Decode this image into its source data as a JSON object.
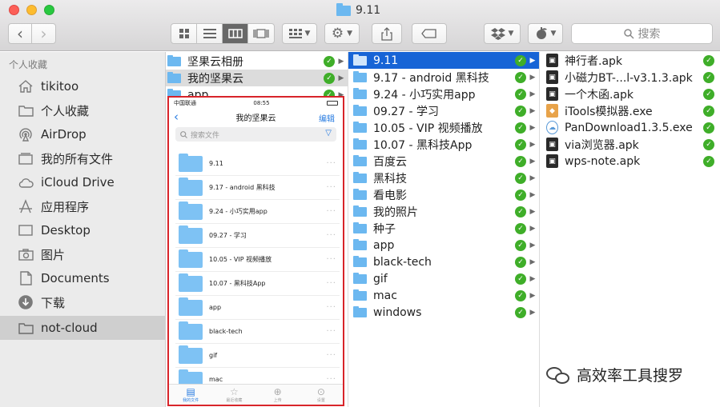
{
  "window": {
    "title": "9.11"
  },
  "toolbar": {
    "back_glyph": "‹",
    "forward_glyph": "›",
    "view_modes": [
      "icon",
      "list",
      "column",
      "gallery"
    ],
    "search_placeholder": "搜索"
  },
  "sidebar": {
    "heading": "个人收藏",
    "items": [
      {
        "label": "tikitoo",
        "icon": "home-icon"
      },
      {
        "label": "个人收藏",
        "icon": "folder-icon"
      },
      {
        "label": "AirDrop",
        "icon": "airdrop-icon"
      },
      {
        "label": "我的所有文件",
        "icon": "all-files-icon"
      },
      {
        "label": "iCloud Drive",
        "icon": "cloud-icon"
      },
      {
        "label": "应用程序",
        "icon": "applications-icon"
      },
      {
        "label": "Desktop",
        "icon": "desktop-icon"
      },
      {
        "label": "图片",
        "icon": "camera-icon"
      },
      {
        "label": "Documents",
        "icon": "document-icon"
      },
      {
        "label": "下载",
        "icon": "download-icon"
      },
      {
        "label": "not-cloud",
        "icon": "folder-icon",
        "selected": true
      }
    ]
  },
  "column1": {
    "items": [
      {
        "name": "坚果云相册"
      },
      {
        "name": "我的坚果云",
        "highlighted": true
      },
      {
        "name": "app"
      }
    ]
  },
  "column2": {
    "items": [
      {
        "name": "9.11",
        "selected": true
      },
      {
        "name": "9.17 - android 黑科技"
      },
      {
        "name": "9.24 - 小巧实用app"
      },
      {
        "name": "09.27 - 学习"
      },
      {
        "name": "10.05 - VIP 视频播放"
      },
      {
        "name": "10.07 - 黑科技App"
      },
      {
        "name": "百度云"
      },
      {
        "name": "黑科技"
      },
      {
        "name": "看电影"
      },
      {
        "name": "我的照片"
      },
      {
        "name": "种子"
      },
      {
        "name": "app"
      },
      {
        "name": "black-tech"
      },
      {
        "name": "gif"
      },
      {
        "name": "mac"
      },
      {
        "name": "windows"
      }
    ]
  },
  "column3": {
    "items": [
      {
        "name": "神行者.apk",
        "kind": "apk"
      },
      {
        "name": "小磁力BT-...l-v3.1.3.apk",
        "kind": "apk"
      },
      {
        "name": "一个木函.apk",
        "kind": "apk"
      },
      {
        "name": "iTools模拟器.exe",
        "kind": "exe"
      },
      {
        "name": "PanDownload1.3.5.exe",
        "kind": "cloud"
      },
      {
        "name": "via浏览器.apk",
        "kind": "apk"
      },
      {
        "name": "wps-note.apk",
        "kind": "apk"
      }
    ]
  },
  "phone": {
    "carrier": "中国联通",
    "time": "08:55",
    "title": "我的坚果云",
    "edit_label": "编辑",
    "search_placeholder": "搜索文件",
    "items": [
      "9.11",
      "9.17 - android 黑科技",
      "9.24 - 小巧实用app",
      "09.27 - 学习",
      "10.05 - VIP 视频播放",
      "10.07 - 黑科技App",
      "app",
      "black-tech",
      "gif",
      "mac"
    ],
    "tabs": [
      {
        "label": "我的文件",
        "active": true
      },
      {
        "label": "最近收藏"
      },
      {
        "label": "上传"
      },
      {
        "label": "设置"
      }
    ]
  },
  "watermark": {
    "text": "高效率工具搜罗"
  },
  "colors": {
    "selection": "#1764d6",
    "sync_check": "#3fae29",
    "folder": "#6cb8f0",
    "phone_border": "#d8242a"
  }
}
